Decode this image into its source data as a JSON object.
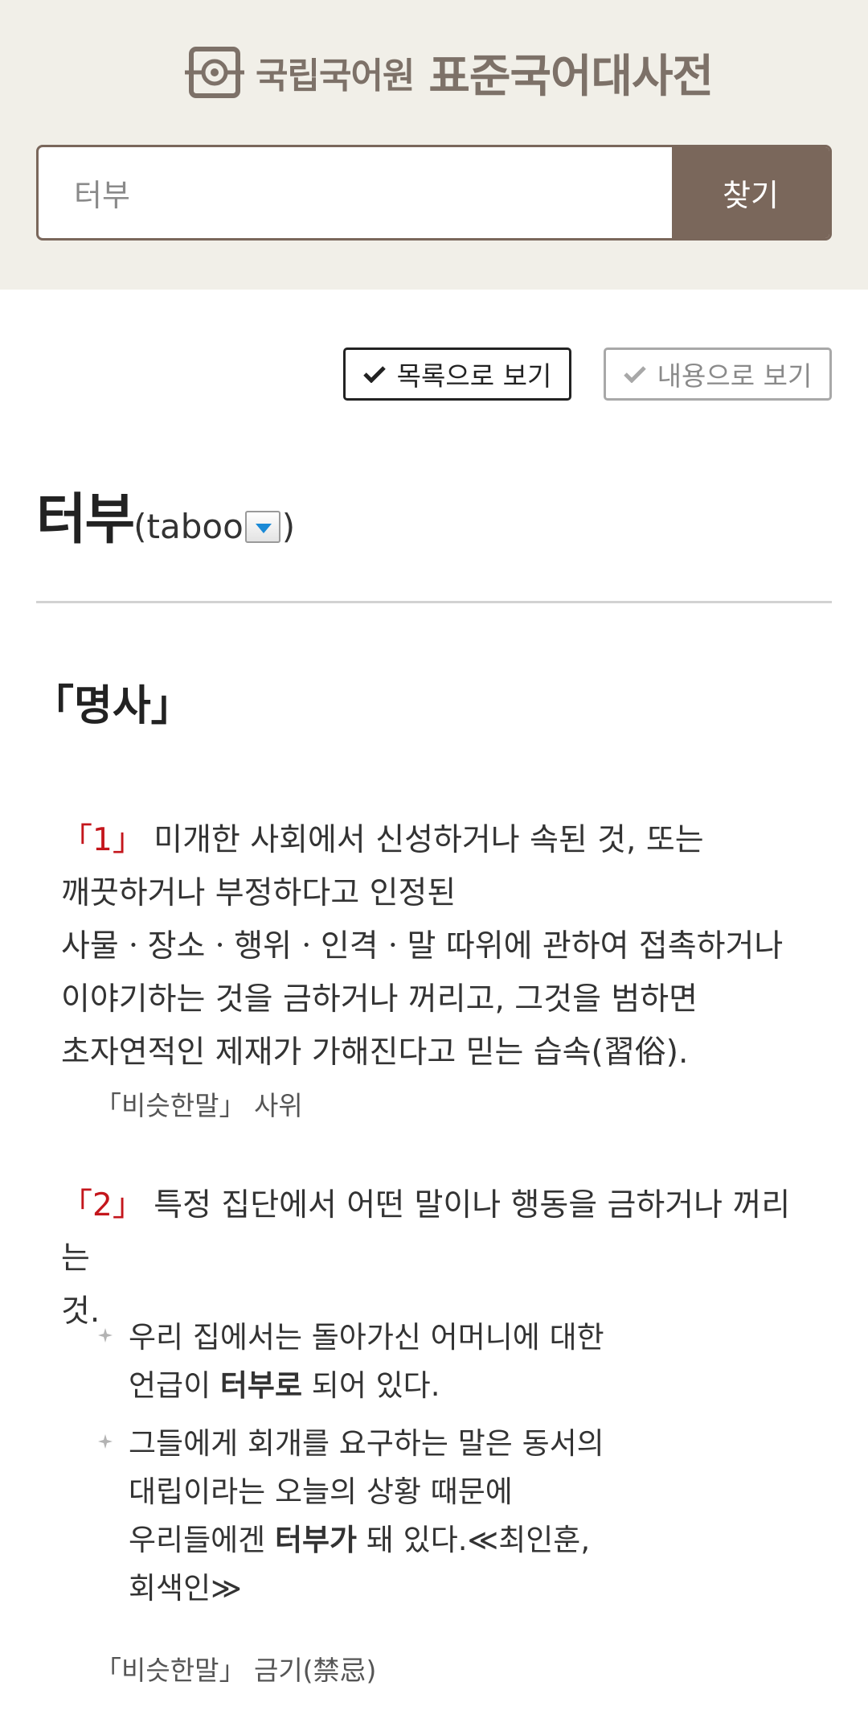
{
  "header": {
    "logo_small": "국립국어원",
    "logo_big": "표준국어대사전"
  },
  "search": {
    "value": "터부",
    "button_label": "찾기"
  },
  "view_toggle": {
    "list_label": "목록으로 보기",
    "content_label": "내용으로 보기",
    "selected": "list"
  },
  "entry": {
    "headword": "터부",
    "origin_open": "(taboo",
    "origin_close": ")",
    "part_of_speech": "「명사」",
    "senses": [
      {
        "number": "「1」",
        "lines": [
          "미개한 사회에서 신성하거나 속된 것, 또는",
          "깨끗하거나 부정하다고 인정된",
          "사물ㆍ장소ㆍ행위ㆍ인격ㆍ말 따위에 관하여 접촉하거나",
          "이야기하는 것을 금하거나 꺼리고, 그것을 범하면",
          "초자연적인 제재가 가해진다고 믿는 습속(習俗)."
        ],
        "synonym_label": "「비슷한말」",
        "synonym": "사위"
      },
      {
        "number": "「2」",
        "lines": [
          "특정 집단에서 어떤 말이나 행동을 금하거나 꺼리는",
          "것."
        ],
        "examples": [
          {
            "line1": "우리 집에서는 돌아가신 어머니에 대한",
            "pre": "언급이 ",
            "bold": "터부로",
            "post": " 되어 있다."
          },
          {
            "line1": "그들에게 회개를 요구하는 말은 동서의",
            "line2": "대립이라는 오늘의 상황 때문에",
            "pre": "우리들에겐 ",
            "bold": "터부가",
            "post": " 돼 있다.≪최인훈,",
            "line4": "회색인≫"
          }
        ],
        "synonym_label": "「비슷한말」",
        "synonym": "금기(禁忌)"
      }
    ]
  },
  "colors": {
    "brand": "#7a675b",
    "header_bg": "#f1efe8",
    "sense_number": "#c4161c",
    "dropdown_arrow": "#1b8ad6"
  }
}
